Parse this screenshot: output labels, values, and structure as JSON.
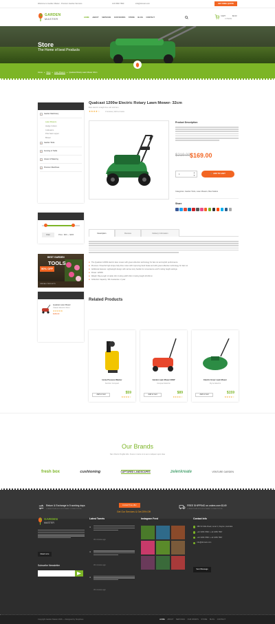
{
  "topbar": {
    "welcome": "Welcome to Garden Master - Premium Garden Services",
    "phone": "123 4560 7890",
    "email": "info@domain.com",
    "quote_btn": "GET FREE QUOTE"
  },
  "header": {
    "logo_top": "GARDEN",
    "logo_bottom": "MASTER",
    "nav": [
      "HOME",
      "ABOUT",
      "SERVICES",
      "OUR WORKS",
      "STORE",
      "BLOG",
      "CONTACT"
    ],
    "cart_label": "CART",
    "cart_total": "$0.00",
    "cart_items": "0 ITEMS"
  },
  "banner": {
    "title": "Store",
    "subtitle": "The Home of best Products"
  },
  "breadcrumb": [
    "Home",
    "Shop",
    "Lawn Mowers",
    "Qualcast Rotary Lawn Mower 32cm"
  ],
  "sidebar": {
    "categories_title": "PRODUCTS CATEGORIES",
    "categories": [
      {
        "label": "Garden Machinery",
        "sub": [
          "Lawn Mowers",
          "Hedge Cutters",
          "Cultivators",
          "Pole Saw Lopper",
          "Blower"
        ]
      },
      {
        "label": "Garden Tools"
      },
      {
        "label": "Fencing & Trellis"
      },
      {
        "label": "Hoses & Watering"
      },
      {
        "label": "Premium Machines"
      }
    ],
    "filter_title": "FILTER BY PRICE",
    "filter_btn": "Filter",
    "price_range": "Price : $60 — $200",
    "promo": {
      "line1": "BEST GARDEN",
      "line2": "TOOLS",
      "discount": "50% OFF",
      "cta": "VIEW ALL PRODUCTS"
    },
    "featured_title": "FEATURED PRODUCT",
    "featured_name": "Qualcast Lawn Mower",
    "featured_sub": "Classic Electric 32cm",
    "featured_price": "$169.00"
  },
  "product": {
    "title": "Qualcast 1200w Electric Rotary Lawn Mower- 32cm",
    "brand": "Best electric straight line sub tool item",
    "reviews": "3 reviews  |  Add a review",
    "desc_title": "Product Description",
    "old_price": "$219.00",
    "price": "$169.00",
    "qty": "1",
    "add_to_cart": "ADD TO CART",
    "meta": "Categories: Garden Tools, Lawn Mowers, Best Sellers",
    "share": "Share"
  },
  "tabs": {
    "labels": [
      "Description",
      "Reviews",
      "Delivery Information"
    ]
  },
  "features": [
    "The Qualcast 1200W electric lawn mower with great collection technology for fast cut and stylish performance",
    "Premium: Powerful high torque fully drive motor with improving hand brake and with great collection technology for fast cut",
    "Additional features: Lightweight design with narrow sixty handle for convenience and 5 cutting height settings",
    "Power: 1200W",
    "Weight: 8kg   Length of cable 10m   Cutting width 32cm   Cutting height 20-60mm",
    "Collection Capacity: 30L   Guarantee: 2 year"
  ],
  "related": {
    "title": "Related Products",
    "items": [
      {
        "name": "Home Pressure Washer",
        "sub": "Karcher Compact",
        "price": "$59",
        "btn": "Add to Cart"
      },
      {
        "name": "Garden Lawn Mower 900W",
        "sub": "Compact Electric",
        "price": "$89",
        "btn": "Add to Cart"
      },
      {
        "name": "Electric Hover Lawn Mower",
        "sub": "Flymo Electric",
        "price": "$159",
        "btn": "Add to Cart"
      }
    ]
  },
  "brands": {
    "title": "Our Brands",
    "subtitle": "Nam liberto fringilla felis. Fusce mi ante sit ut aut ut aliquam quis vitae",
    "logos": [
      "fresh box",
      "cushioning",
      "CAPTURED LANDSCAPES",
      "zelenkreate",
      "VENTURE GARDEN"
    ]
  },
  "service_strip": [
    {
      "title": "Return & Exchange in 5 working days",
      "sub": "LOREM IPSUM DOLOR SIT AMET CONSECTETUR"
    },
    {
      "badge": "Limited Time offer",
      "title": "Get Our Services & Get 25% Off"
    },
    {
      "title": "FREE SHIPPING on orders over $149",
      "sub": "LOREM IPSUM DOLOR SIT AMET CONSECTETUR"
    }
  ],
  "footer": {
    "read_more": "Read more",
    "newsletter_title": "Subscribe Newsletter",
    "tweets_title": "Latest Tweets",
    "tweet_time": "30 minutes ago",
    "insta_title": "Instagram Feed",
    "contact_title": "Contact Info",
    "contact": [
      "380 St Kilda Road, Level 1, Dayton, Australia",
      "+12 3456 7890 / +12 3456 7897",
      "+12 3456 7890 / +12 3456 7897",
      "info@domain.com"
    ],
    "send_msg": "Send Message"
  },
  "bottombar": {
    "copyright": "Copyright Garden Master 2016 — Designed by Templines",
    "nav": [
      "HOME",
      "ABOUT",
      "SERVICES",
      "OUR WORKS",
      "STORE",
      "BLOG",
      "CONTACT"
    ]
  }
}
